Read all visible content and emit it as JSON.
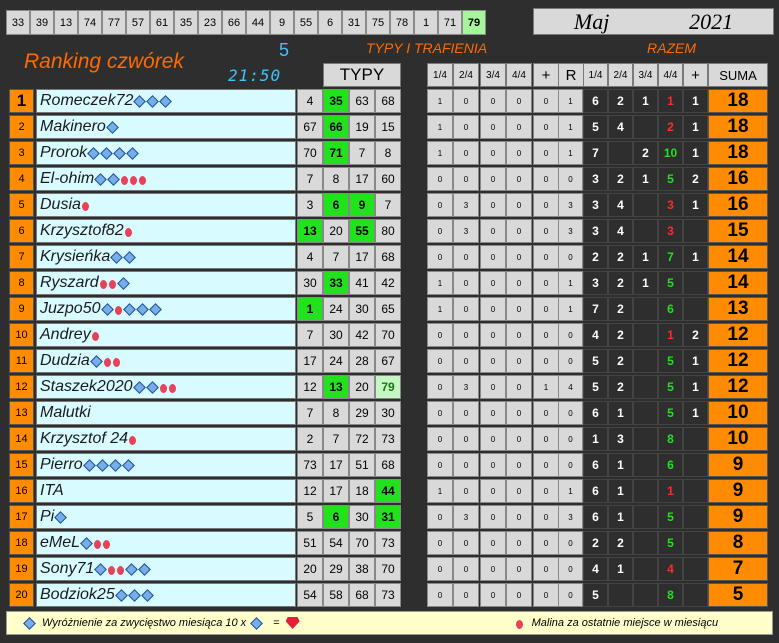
{
  "top_numbers": [
    "33",
    "39",
    "13",
    "74",
    "77",
    "57",
    "61",
    "35",
    "23",
    "66",
    "44",
    "9",
    "55",
    "6",
    "31",
    "75",
    "78",
    "1",
    "71",
    "79"
  ],
  "top_highlight_index": 19,
  "month": {
    "name": "Maj",
    "year": "2021"
  },
  "title": "Ranking czwórek",
  "count": "5",
  "clock": "21:50",
  "section_typy": "TYPY I TRAFIENIA",
  "section_razem": "RAZEM",
  "col_typy": "TYPY",
  "cols_left": [
    "1/4",
    "2/4",
    "3/4",
    "4/4",
    "+",
    "R"
  ],
  "cols_right": [
    "1/4",
    "2/4",
    "3/4",
    "4/4",
    "+"
  ],
  "col_suma": "SUMA",
  "rows": [
    {
      "rank": "1",
      "name": "Romeczek72",
      "icons": "ddd",
      "typy": [
        "4",
        "35",
        "63",
        "68"
      ],
      "hl": [
        0,
        1,
        0,
        0
      ],
      "sc": [
        "1",
        "0",
        "0",
        "0",
        "0",
        "1"
      ],
      "rz": [
        "6",
        "2",
        "1",
        "1",
        "1"
      ],
      "rc": [
        "",
        "",
        "",
        "r",
        ""
      ],
      "suma": "18"
    },
    {
      "rank": "2",
      "name": "Makinero",
      "icons": "d",
      "typy": [
        "67",
        "66",
        "19",
        "15"
      ],
      "hl": [
        0,
        1,
        0,
        0
      ],
      "sc": [
        "1",
        "0",
        "0",
        "0",
        "0",
        "1"
      ],
      "rz": [
        "5",
        "4",
        "",
        "2",
        "1"
      ],
      "rc": [
        "",
        "",
        "",
        "r",
        ""
      ],
      "suma": "18"
    },
    {
      "rank": "3",
      "name": "Prorok",
      "icons": "dddd",
      "typy": [
        "70",
        "71",
        "7",
        "8"
      ],
      "hl": [
        0,
        1,
        0,
        0
      ],
      "sc": [
        "1",
        "0",
        "0",
        "0",
        "0",
        "1"
      ],
      "rz": [
        "7",
        "",
        "2",
        "10",
        "1"
      ],
      "rc": [
        "",
        "",
        "",
        "g",
        ""
      ],
      "suma": "18"
    },
    {
      "rank": "4",
      "name": "El-ohim",
      "icons": "ddbbb",
      "typy": [
        "7",
        "8",
        "17",
        "60"
      ],
      "hl": [
        0,
        0,
        0,
        0
      ],
      "sc": [
        "0",
        "0",
        "0",
        "0",
        "0",
        "0"
      ],
      "rz": [
        "3",
        "2",
        "1",
        "5",
        "2"
      ],
      "rc": [
        "",
        "",
        "",
        "g",
        ""
      ],
      "suma": "16"
    },
    {
      "rank": "5",
      "name": "Dusia",
      "icons": "b",
      "typy": [
        "3",
        "6",
        "9",
        "7"
      ],
      "hl": [
        0,
        1,
        1,
        0
      ],
      "sc": [
        "0",
        "3",
        "0",
        "0",
        "0",
        "3"
      ],
      "rz": [
        "3",
        "4",
        "",
        "3",
        "1"
      ],
      "rc": [
        "",
        "",
        "",
        "r",
        ""
      ],
      "suma": "16"
    },
    {
      "rank": "6",
      "name": "Krzysztof82",
      "icons": "b",
      "typy": [
        "13",
        "20",
        "55",
        "80"
      ],
      "hl": [
        1,
        0,
        1,
        0
      ],
      "sc": [
        "0",
        "3",
        "0",
        "0",
        "0",
        "3"
      ],
      "rz": [
        "3",
        "4",
        "",
        "3",
        ""
      ],
      "rc": [
        "",
        "",
        "",
        "r",
        ""
      ],
      "suma": "15"
    },
    {
      "rank": "7",
      "name": "Krysieńka",
      "icons": "dd",
      "typy": [
        "4",
        "7",
        "17",
        "68"
      ],
      "hl": [
        0,
        0,
        0,
        0
      ],
      "sc": [
        "0",
        "0",
        "0",
        "0",
        "0",
        "0"
      ],
      "rz": [
        "2",
        "2",
        "1",
        "7",
        "1"
      ],
      "rc": [
        "",
        "",
        "",
        "g",
        ""
      ],
      "suma": "14"
    },
    {
      "rank": "8",
      "name": "Ryszard",
      "icons": "bbd",
      "typy": [
        "30",
        "33",
        "41",
        "42"
      ],
      "hl": [
        0,
        1,
        0,
        0
      ],
      "sc": [
        "1",
        "0",
        "0",
        "0",
        "0",
        "1"
      ],
      "rz": [
        "3",
        "2",
        "1",
        "5",
        ""
      ],
      "rc": [
        "",
        "",
        "",
        "g",
        ""
      ],
      "suma": "14"
    },
    {
      "rank": "9",
      "name": "Juzpo50",
      "icons": "dbddd",
      "typy": [
        "1",
        "24",
        "30",
        "65"
      ],
      "hl": [
        1,
        0,
        0,
        0
      ],
      "sc": [
        "1",
        "0",
        "0",
        "0",
        "0",
        "1"
      ],
      "rz": [
        "7",
        "2",
        "",
        "6",
        ""
      ],
      "rc": [
        "",
        "",
        "",
        "g",
        ""
      ],
      "suma": "13"
    },
    {
      "rank": "10",
      "name": "Andrey",
      "icons": "b",
      "typy": [
        "7",
        "30",
        "42",
        "70"
      ],
      "hl": [
        0,
        0,
        0,
        0
      ],
      "sc": [
        "0",
        "0",
        "0",
        "0",
        "0",
        "0"
      ],
      "rz": [
        "4",
        "2",
        "",
        "1",
        "2"
      ],
      "rc": [
        "",
        "",
        "",
        "r",
        ""
      ],
      "suma": "12"
    },
    {
      "rank": "11",
      "name": "Dudzia",
      "icons": "dbb",
      "typy": [
        "17",
        "24",
        "28",
        "67"
      ],
      "hl": [
        0,
        0,
        0,
        0
      ],
      "sc": [
        "0",
        "0",
        "0",
        "0",
        "0",
        "0"
      ],
      "rz": [
        "5",
        "2",
        "",
        "5",
        "1"
      ],
      "rc": [
        "",
        "",
        "",
        "g",
        ""
      ],
      "suma": "12"
    },
    {
      "rank": "12",
      "name": "Staszek2020",
      "icons": "ddbb",
      "typy": [
        "12",
        "13",
        "20",
        "79"
      ],
      "hl": [
        0,
        1,
        0,
        2
      ],
      "sc": [
        "0",
        "3",
        "0",
        "0",
        "1",
        "4"
      ],
      "rz": [
        "5",
        "2",
        "",
        "5",
        "1"
      ],
      "rc": [
        "",
        "",
        "",
        "g",
        ""
      ],
      "suma": "12"
    },
    {
      "rank": "13",
      "name": "Malutki",
      "icons": "",
      "typy": [
        "7",
        "8",
        "29",
        "30"
      ],
      "hl": [
        0,
        0,
        0,
        0
      ],
      "sc": [
        "0",
        "0",
        "0",
        "0",
        "0",
        "0"
      ],
      "rz": [
        "6",
        "1",
        "",
        "5",
        "1"
      ],
      "rc": [
        "",
        "",
        "",
        "g",
        ""
      ],
      "suma": "10"
    },
    {
      "rank": "14",
      "name": "Krzysztof 24",
      "icons": "b",
      "typy": [
        "2",
        "7",
        "72",
        "73"
      ],
      "hl": [
        0,
        0,
        0,
        0
      ],
      "sc": [
        "0",
        "0",
        "0",
        "0",
        "0",
        "0"
      ],
      "rz": [
        "1",
        "3",
        "",
        "8",
        ""
      ],
      "rc": [
        "",
        "",
        "",
        "g",
        ""
      ],
      "suma": "10"
    },
    {
      "rank": "15",
      "name": "Pierro",
      "icons": "dddd",
      "typy": [
        "73",
        "17",
        "51",
        "68"
      ],
      "hl": [
        0,
        0,
        0,
        0
      ],
      "sc": [
        "0",
        "0",
        "0",
        "0",
        "0",
        "0"
      ],
      "rz": [
        "6",
        "1",
        "",
        "6",
        ""
      ],
      "rc": [
        "",
        "",
        "",
        "g",
        ""
      ],
      "suma": "9"
    },
    {
      "rank": "16",
      "name": "ITA",
      "icons": "",
      "typy": [
        "12",
        "17",
        "18",
        "44"
      ],
      "hl": [
        0,
        0,
        0,
        1
      ],
      "sc": [
        "1",
        "0",
        "0",
        "0",
        "0",
        "1"
      ],
      "rz": [
        "6",
        "1",
        "",
        "1",
        ""
      ],
      "rc": [
        "",
        "",
        "",
        "r",
        ""
      ],
      "suma": "9"
    },
    {
      "rank": "17",
      "name": "Pi",
      "icons": "d",
      "typy": [
        "5",
        "6",
        "30",
        "31"
      ],
      "hl": [
        0,
        1,
        0,
        1
      ],
      "sc": [
        "0",
        "3",
        "0",
        "0",
        "0",
        "3"
      ],
      "rz": [
        "6",
        "1",
        "",
        "5",
        ""
      ],
      "rc": [
        "",
        "",
        "",
        "g",
        ""
      ],
      "suma": "9"
    },
    {
      "rank": "18",
      "name": "eMeL",
      "icons": "dbb",
      "typy": [
        "51",
        "54",
        "70",
        "73"
      ],
      "hl": [
        0,
        0,
        0,
        0
      ],
      "sc": [
        "0",
        "0",
        "0",
        "0",
        "0",
        "0"
      ],
      "rz": [
        "2",
        "2",
        "",
        "5",
        ""
      ],
      "rc": [
        "",
        "",
        "",
        "g",
        ""
      ],
      "suma": "8"
    },
    {
      "rank": "19",
      "name": "Sony71",
      "icons": "dbbdd",
      "typy": [
        "20",
        "29",
        "38",
        "70"
      ],
      "hl": [
        0,
        0,
        0,
        0
      ],
      "sc": [
        "0",
        "0",
        "0",
        "0",
        "0",
        "0"
      ],
      "rz": [
        "4",
        "1",
        "",
        "4",
        ""
      ],
      "rc": [
        "",
        "",
        "",
        "r",
        ""
      ],
      "suma": "7"
    },
    {
      "rank": "20",
      "name": "Bodziok25",
      "icons": "ddd",
      "typy": [
        "54",
        "58",
        "68",
        "73"
      ],
      "hl": [
        0,
        0,
        0,
        0
      ],
      "sc": [
        "0",
        "0",
        "0",
        "0",
        "0",
        "0"
      ],
      "rz": [
        "5",
        "",
        "",
        "8",
        ""
      ],
      "rc": [
        "",
        "",
        "",
        "g",
        ""
      ],
      "suma": "5"
    }
  ],
  "footer": {
    "left_text": "Wyróżnienie za zwycięstwo miesiąca  10 x",
    "eq": "=",
    "right_text": "Malina za ostatnie miejsce w miesiącu"
  }
}
